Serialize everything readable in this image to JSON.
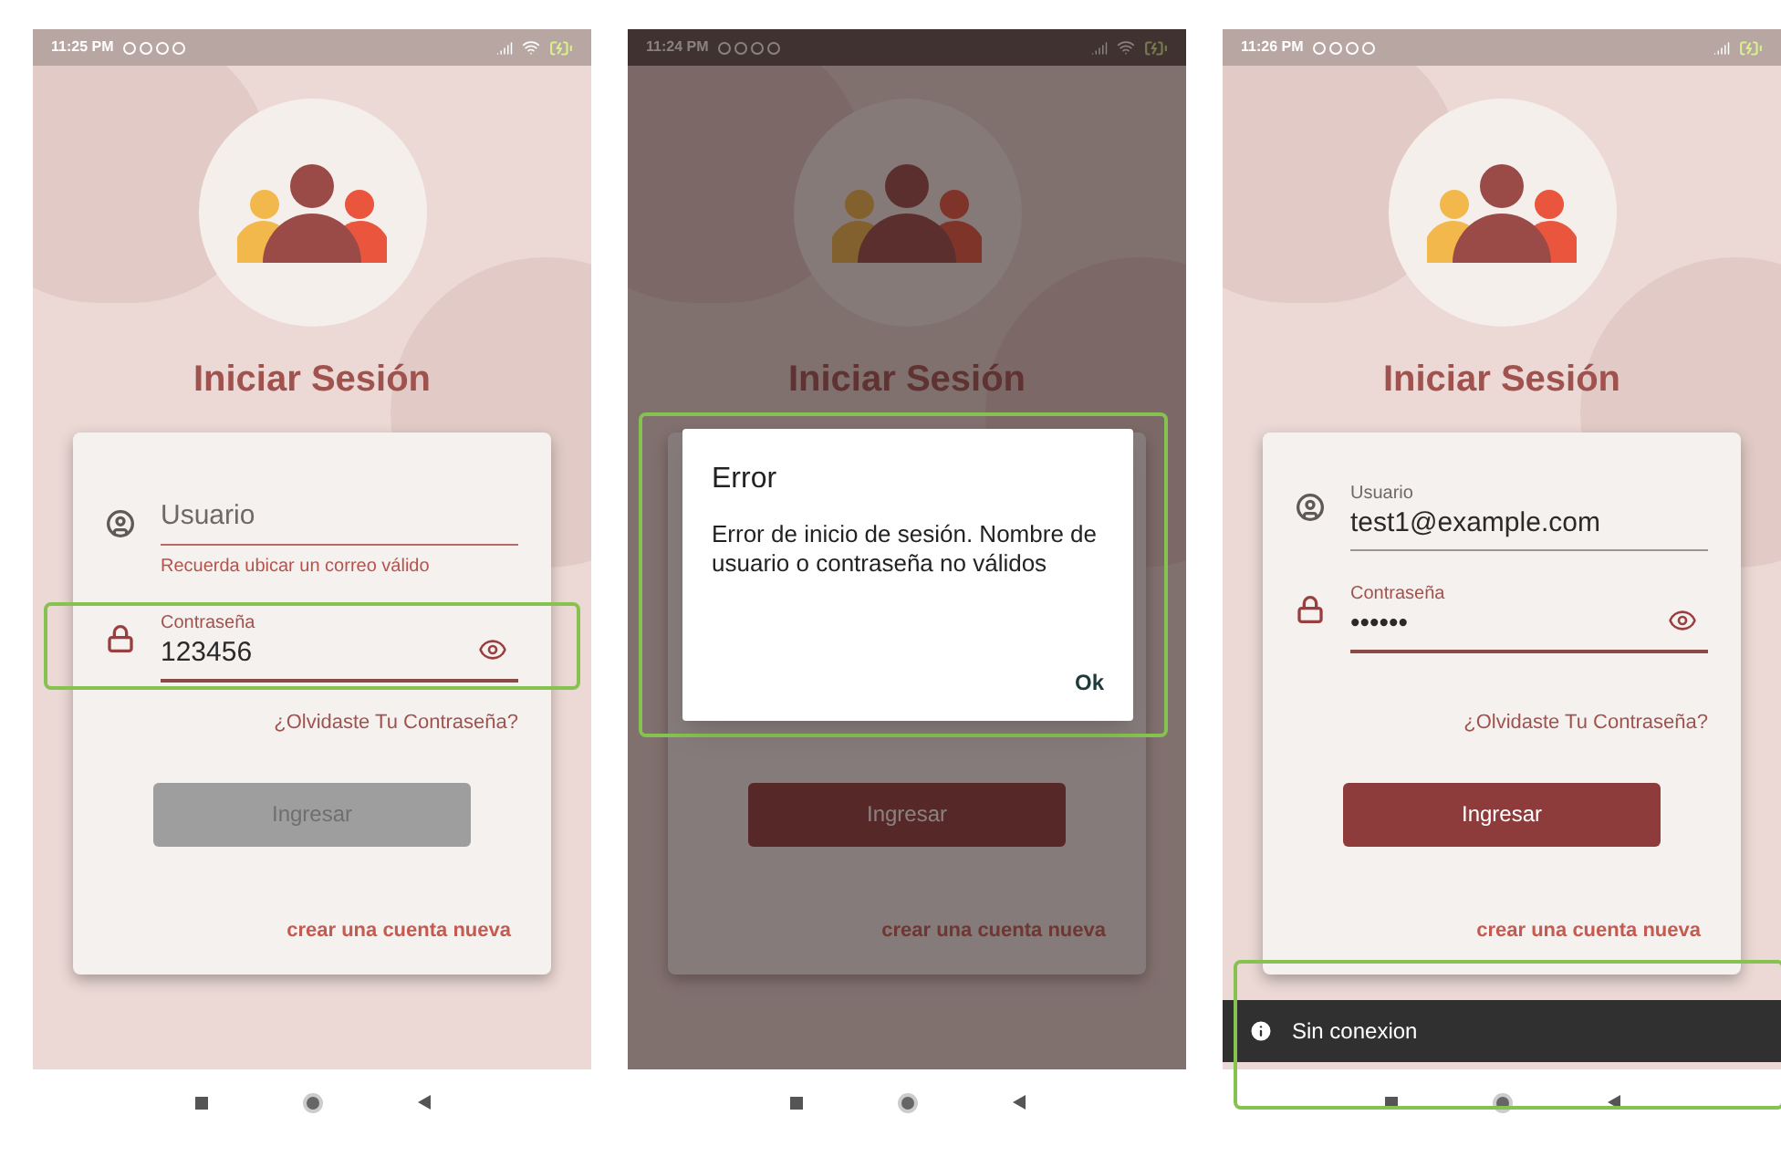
{
  "screens": [
    {
      "status": {
        "time": "11:25 PM",
        "wifi": true
      },
      "dimmed": false,
      "title": "Iniciar Sesión",
      "fields": [
        {
          "kind": "user",
          "placeholder": "Usuario",
          "helper": "Recuerda ubicar un correo válido",
          "error": true,
          "focused": false,
          "highlighted": false
        },
        {
          "kind": "password",
          "label": "Contraseña",
          "value": "123456",
          "error": false,
          "focused": true,
          "highlighted": true
        }
      ],
      "forgot_link": "¿Olvidaste Tu Contraseña?",
      "submit": {
        "label": "Ingresar",
        "disabled": true
      },
      "register_link": "crear una cuenta nueva"
    },
    {
      "status": {
        "time": "11:24 PM",
        "wifi": true
      },
      "dimmed": true,
      "title": "Iniciar Sesión",
      "submit": {
        "label": "Ingresar",
        "disabled": false
      },
      "register_link": "crear una cuenta nueva",
      "dialog": {
        "title": "Error",
        "message": "Error de inicio de sesión. Nombre de usuario o contraseña no válidos",
        "action": "Ok",
        "highlighted": true
      }
    },
    {
      "status": {
        "time": "11:26 PM",
        "wifi": false
      },
      "dimmed": false,
      "title": "Iniciar Sesión",
      "fields": [
        {
          "kind": "user",
          "label": "Usuario",
          "value": "test1@example.com",
          "error": false,
          "focused": false,
          "highlighted": false
        },
        {
          "kind": "password",
          "label": "Contraseña",
          "value": "••••••",
          "error": false,
          "focused": true,
          "highlighted": false
        }
      ],
      "forgot_link": "¿Olvidaste Tu Contraseña?",
      "submit": {
        "label": "Ingresar",
        "disabled": false
      },
      "register_link": "crear una cuenta nueva",
      "snackbar": {
        "message": "Sin conexion",
        "highlighted": true
      }
    }
  ]
}
